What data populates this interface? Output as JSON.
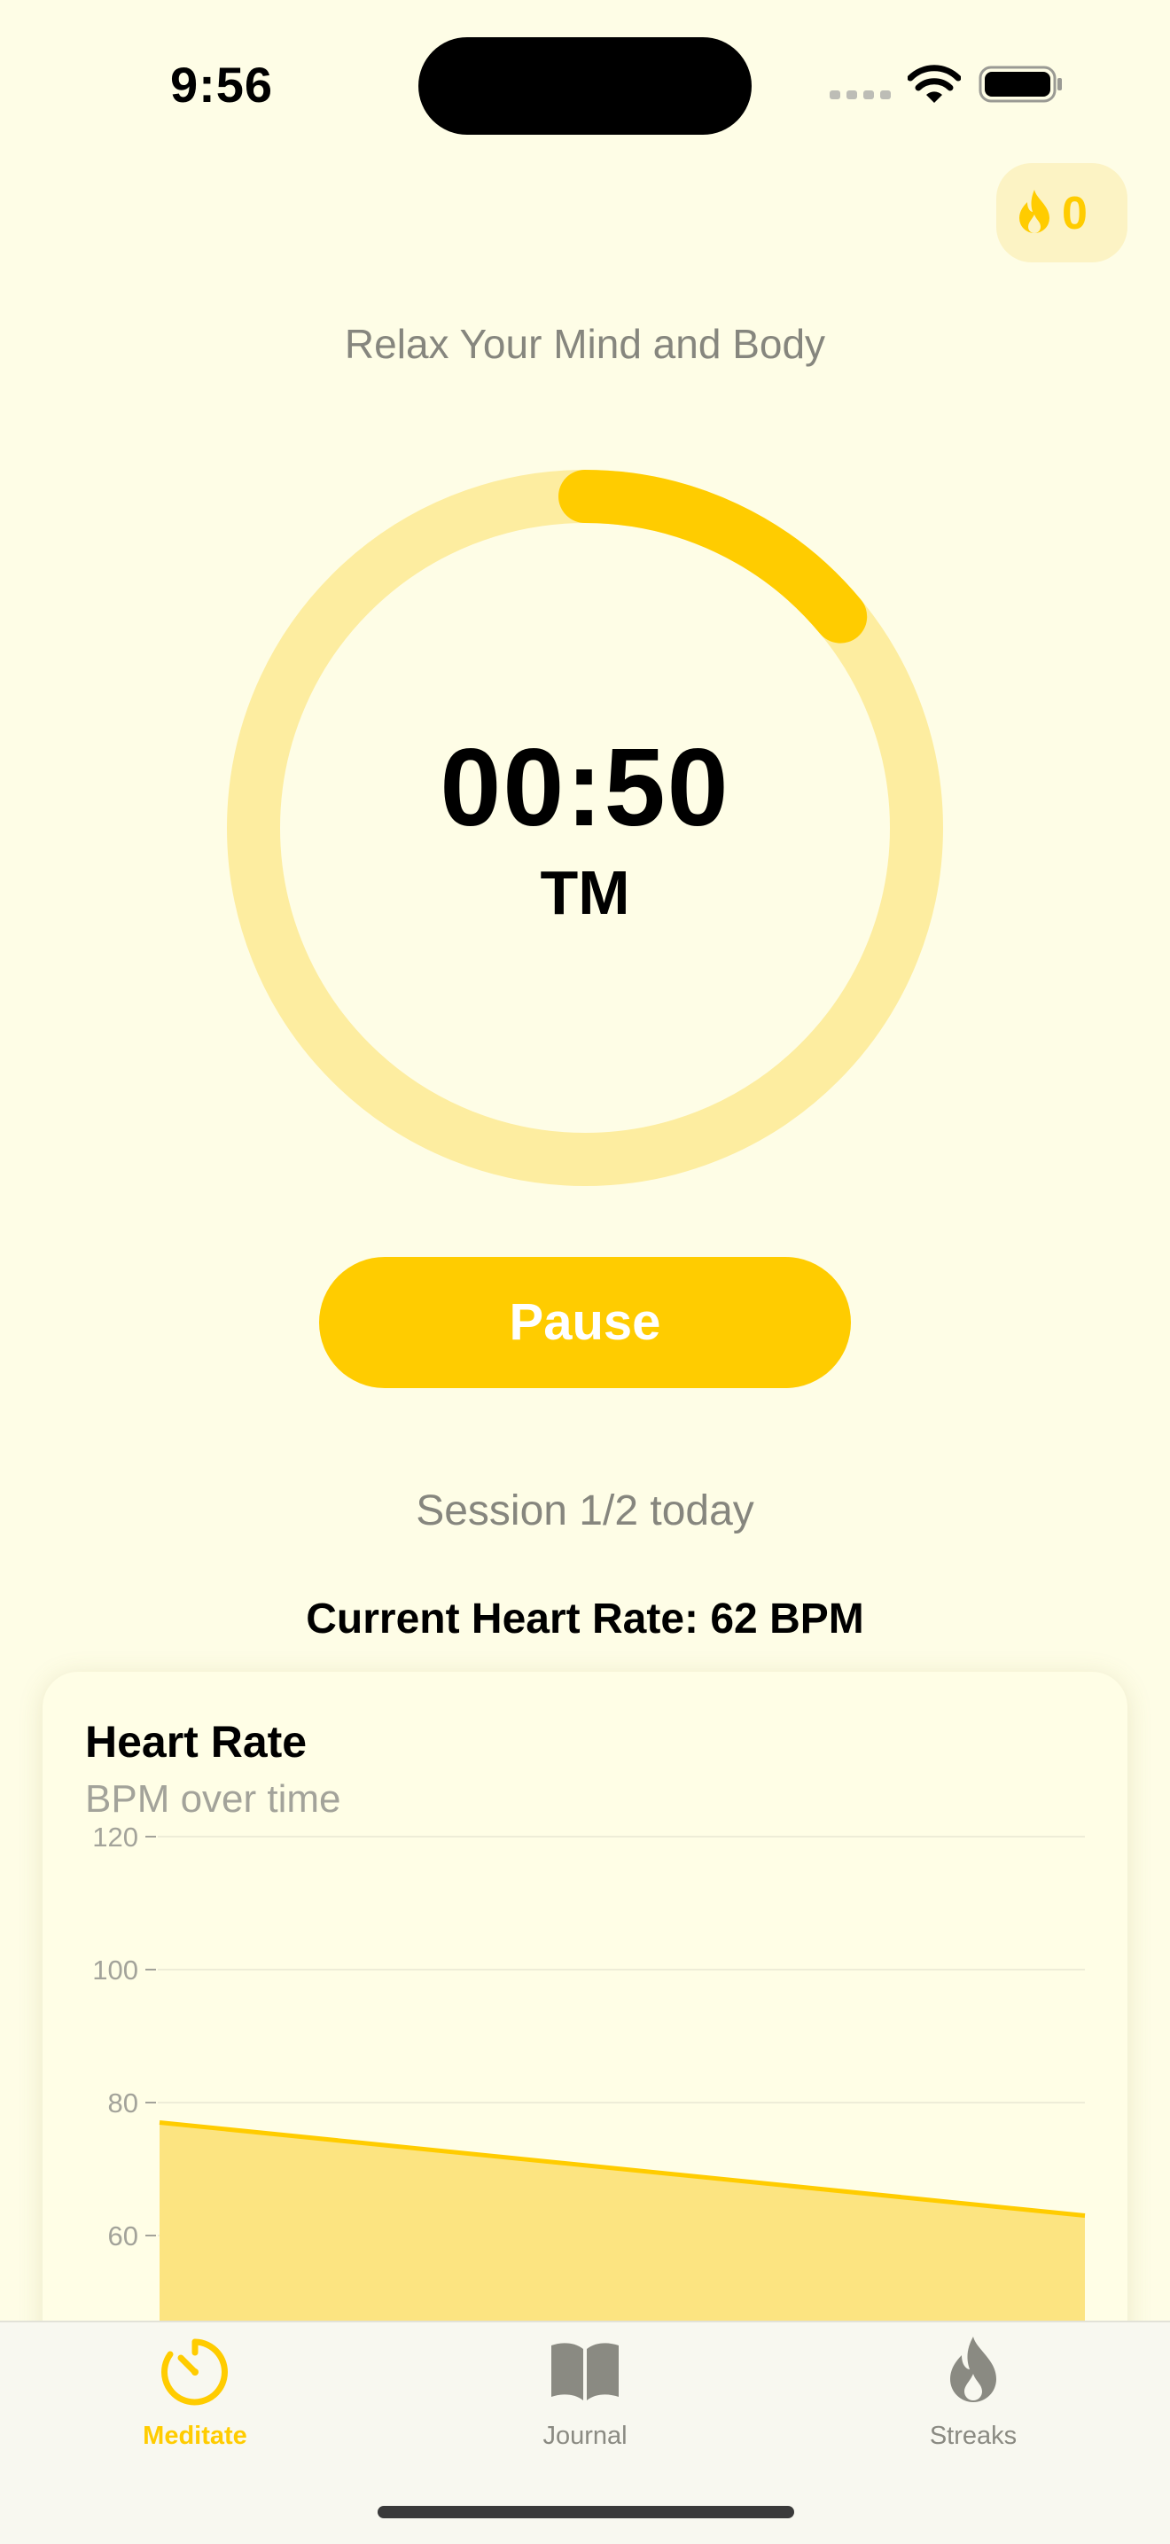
{
  "status_bar": {
    "time": "9:56"
  },
  "streak": {
    "count": "0"
  },
  "subtitle": "Relax Your Mind and Body",
  "timer": {
    "time": "00:50",
    "technique": "TM",
    "progress": 0.14
  },
  "controls": {
    "pause_label": "Pause"
  },
  "session": {
    "text": "Session 1/2 today"
  },
  "heart_rate": {
    "current_text": "Current Heart Rate: 62 BPM"
  },
  "card": {
    "title": "Heart Rate",
    "subtitle": "BPM over time"
  },
  "chart_data": {
    "type": "area",
    "title": "Heart Rate",
    "subtitle": "BPM over time",
    "ylim": [
      40,
      120
    ],
    "yticks": [
      120,
      100,
      80,
      60
    ],
    "series": [
      {
        "values": [
          77,
          63
        ]
      }
    ],
    "grid": true
  },
  "tabs": [
    {
      "label": "Meditate",
      "icon": "timer-icon",
      "active": true
    },
    {
      "label": "Journal",
      "icon": "book-icon",
      "active": false
    },
    {
      "label": "Streaks",
      "icon": "flame-icon",
      "active": false
    }
  ],
  "colors": {
    "accent": "#FFCC00",
    "background": "#FEFDE6",
    "ring_track": "#FDEDA0",
    "chart_fill": "#FCE481",
    "inactive": "#8A8A82"
  }
}
